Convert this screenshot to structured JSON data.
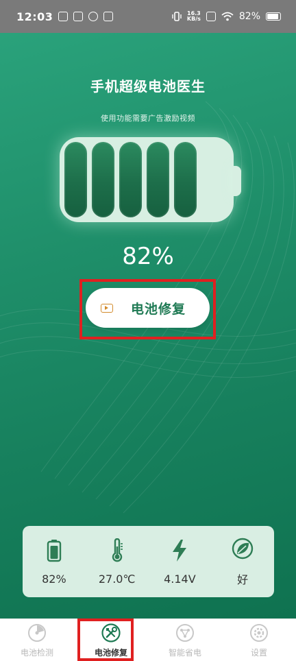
{
  "status_bar": {
    "time": "12:03",
    "net_speed_value": "16.3",
    "net_speed_unit": "KB/s",
    "battery_percent": "82%"
  },
  "app": {
    "title": "手机超级电池医生",
    "subtitle": "使用功能需要广告激励视频"
  },
  "battery": {
    "level_percent": 82,
    "percent_label": "82%",
    "cell_count": 5
  },
  "repair_button": {
    "label": "电池修复",
    "icon": "video-icon"
  },
  "stats": [
    {
      "icon": "battery-icon",
      "value": "82%"
    },
    {
      "icon": "thermometer-icon",
      "value": "27.0℃"
    },
    {
      "icon": "lightning-icon",
      "value": "4.14V"
    },
    {
      "icon": "leaf-icon",
      "value": "好"
    }
  ],
  "tabs": [
    {
      "icon": "battery-check-icon",
      "label": "电池检测",
      "active": false
    },
    {
      "icon": "repair-tools-icon",
      "label": "电池修复",
      "active": true
    },
    {
      "icon": "smart-save-icon",
      "label": "智能省电",
      "active": false
    },
    {
      "icon": "gear-icon",
      "label": "设置",
      "active": false
    }
  ],
  "colors": {
    "accent_green": "#1f8f6a",
    "active_tab": "#1f7a54",
    "highlight_red": "#e02020",
    "video_icon": "#d28a2a"
  }
}
